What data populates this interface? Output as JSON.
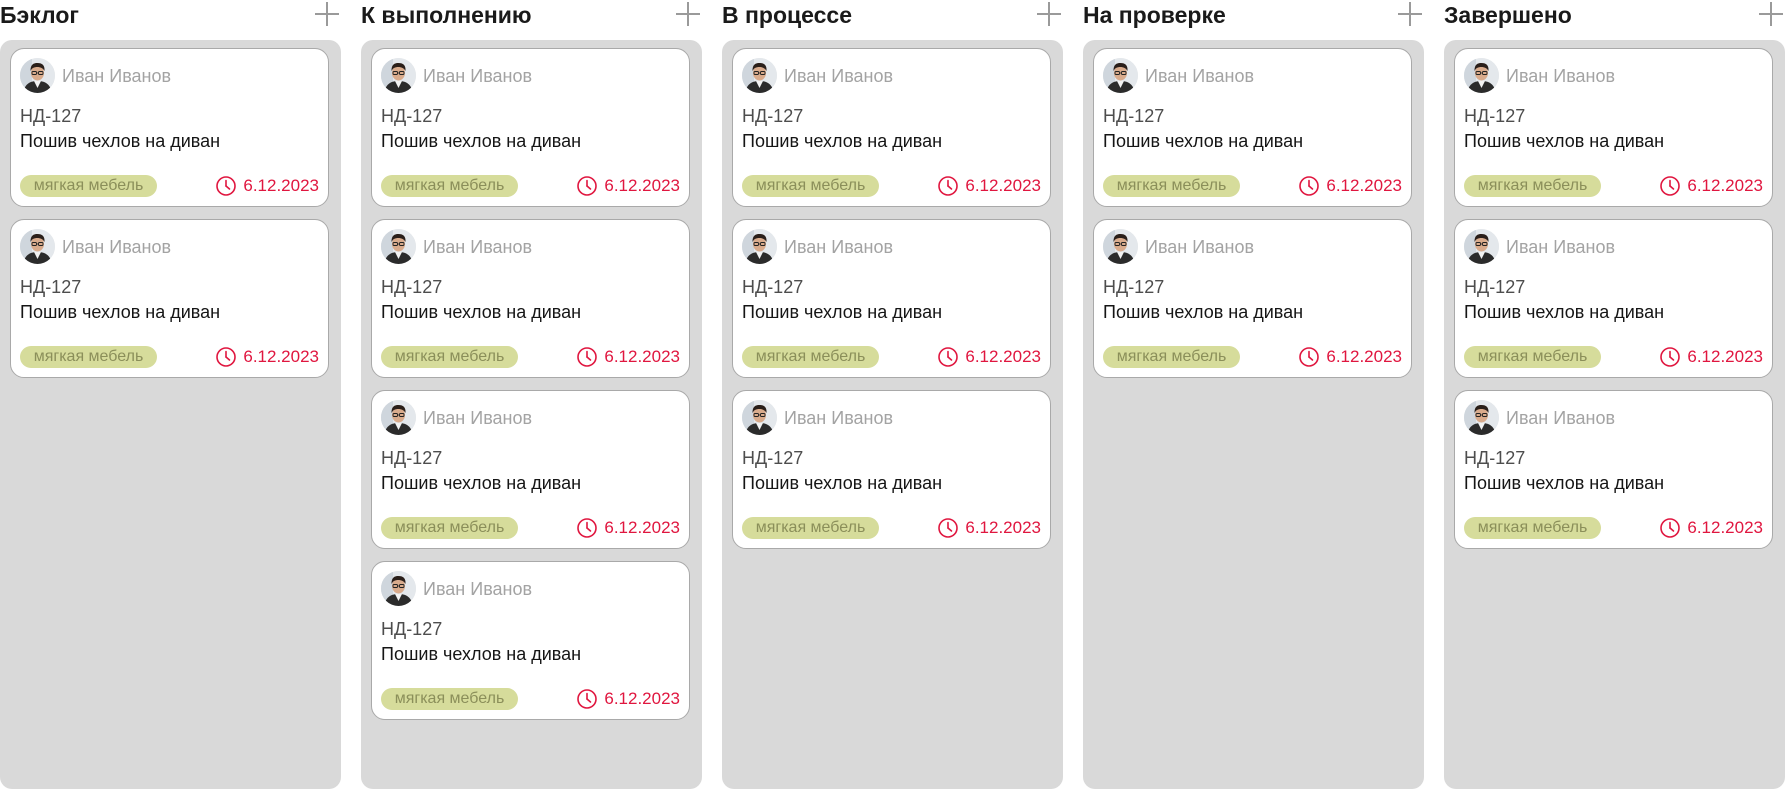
{
  "board": {
    "accent": {
      "column_bg": "#d9d9d9",
      "tag_bg": "#d6dc9b",
      "tag_text": "#8b8f5a",
      "due_color": "#e0163f"
    },
    "add_icon": "plus-icon",
    "due_icon": "clock-icon",
    "columns": [
      {
        "title": "Бэклог",
        "cards": [
          {
            "assignee": "Иван Иванов",
            "id": "НД-127",
            "title": "Пошив чехлов на диван",
            "tag": "мягкая мебель",
            "due": "6.12.2023"
          },
          {
            "assignee": "Иван Иванов",
            "id": "НД-127",
            "title": "Пошив чехлов на диван",
            "tag": "мягкая мебель",
            "due": "6.12.2023"
          }
        ]
      },
      {
        "title": "К выполнению",
        "cards": [
          {
            "assignee": "Иван Иванов",
            "id": "НД-127",
            "title": "Пошив чехлов на диван",
            "tag": "мягкая мебель",
            "due": "6.12.2023"
          },
          {
            "assignee": "Иван Иванов",
            "id": "НД-127",
            "title": "Пошив чехлов на диван",
            "tag": "мягкая мебель",
            "due": "6.12.2023"
          },
          {
            "assignee": "Иван Иванов",
            "id": "НД-127",
            "title": "Пошив чехлов на диван",
            "tag": "мягкая мебель",
            "due": "6.12.2023"
          },
          {
            "assignee": "Иван Иванов",
            "id": "НД-127",
            "title": "Пошив чехлов на диван",
            "tag": "мягкая мебель",
            "due": "6.12.2023"
          }
        ]
      },
      {
        "title": "В процессе",
        "cards": [
          {
            "assignee": "Иван Иванов",
            "id": "НД-127",
            "title": "Пошив чехлов на диван",
            "tag": "мягкая мебель",
            "due": "6.12.2023"
          },
          {
            "assignee": "Иван Иванов",
            "id": "НД-127",
            "title": "Пошив чехлов на диван",
            "tag": "мягкая мебель",
            "due": "6.12.2023"
          },
          {
            "assignee": "Иван Иванов",
            "id": "НД-127",
            "title": "Пошив чехлов на диван",
            "tag": "мягкая мебель",
            "due": "6.12.2023"
          }
        ]
      },
      {
        "title": "На проверке",
        "cards": [
          {
            "assignee": "Иван Иванов",
            "id": "НД-127",
            "title": "Пошив чехлов на диван",
            "tag": "мягкая мебель",
            "due": "6.12.2023"
          },
          {
            "assignee": "Иван Иванов",
            "id": "НД-127",
            "title": "Пошив чехлов на диван",
            "tag": "мягкая мебель",
            "due": "6.12.2023"
          }
        ]
      },
      {
        "title": "Завершено",
        "cards": [
          {
            "assignee": "Иван Иванов",
            "id": "НД-127",
            "title": "Пошив чехлов на диван",
            "tag": "мягкая мебель",
            "due": "6.12.2023"
          },
          {
            "assignee": "Иван Иванов",
            "id": "НД-127",
            "title": "Пошив чехлов на диван",
            "tag": "мягкая мебель",
            "due": "6.12.2023"
          },
          {
            "assignee": "Иван Иванов",
            "id": "НД-127",
            "title": "Пошив чехлов на диван",
            "tag": "мягкая мебель",
            "due": "6.12.2023"
          }
        ]
      }
    ]
  }
}
